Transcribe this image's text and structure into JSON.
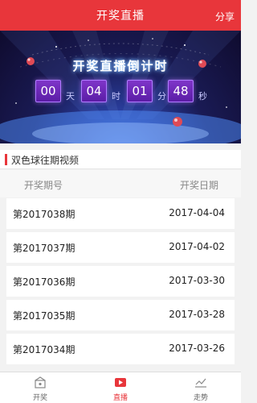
{
  "header": {
    "title": "开奖直播",
    "share_label": "分享"
  },
  "banner": {
    "title": "开奖直播倒计时",
    "countdown": [
      {
        "value": "00",
        "unit": "天"
      },
      {
        "value": "04",
        "unit": "时"
      },
      {
        "value": "01",
        "unit": "分"
      },
      {
        "value": "48",
        "unit": "秒"
      }
    ]
  },
  "section": {
    "title": "双色球往期视频"
  },
  "table": {
    "headers": {
      "period": "开奖期号",
      "date": "开奖日期"
    },
    "rows": [
      {
        "period": "第2017038期",
        "date": "2017-04-04"
      },
      {
        "period": "第2017037期",
        "date": "2017-04-02"
      },
      {
        "period": "第2017036期",
        "date": "2017-03-30"
      },
      {
        "period": "第2017035期",
        "date": "2017-03-28"
      },
      {
        "period": "第2017034期",
        "date": "2017-03-26"
      }
    ]
  },
  "tabbar": {
    "items": [
      {
        "label": "开奖",
        "icon": "lottery-box-icon"
      },
      {
        "label": "直播",
        "icon": "video-play-icon"
      },
      {
        "label": "走势",
        "icon": "trend-chart-icon"
      }
    ],
    "active_index": 1
  },
  "colors": {
    "accent": "#e8363b",
    "countdown": "#6a2bb5"
  }
}
